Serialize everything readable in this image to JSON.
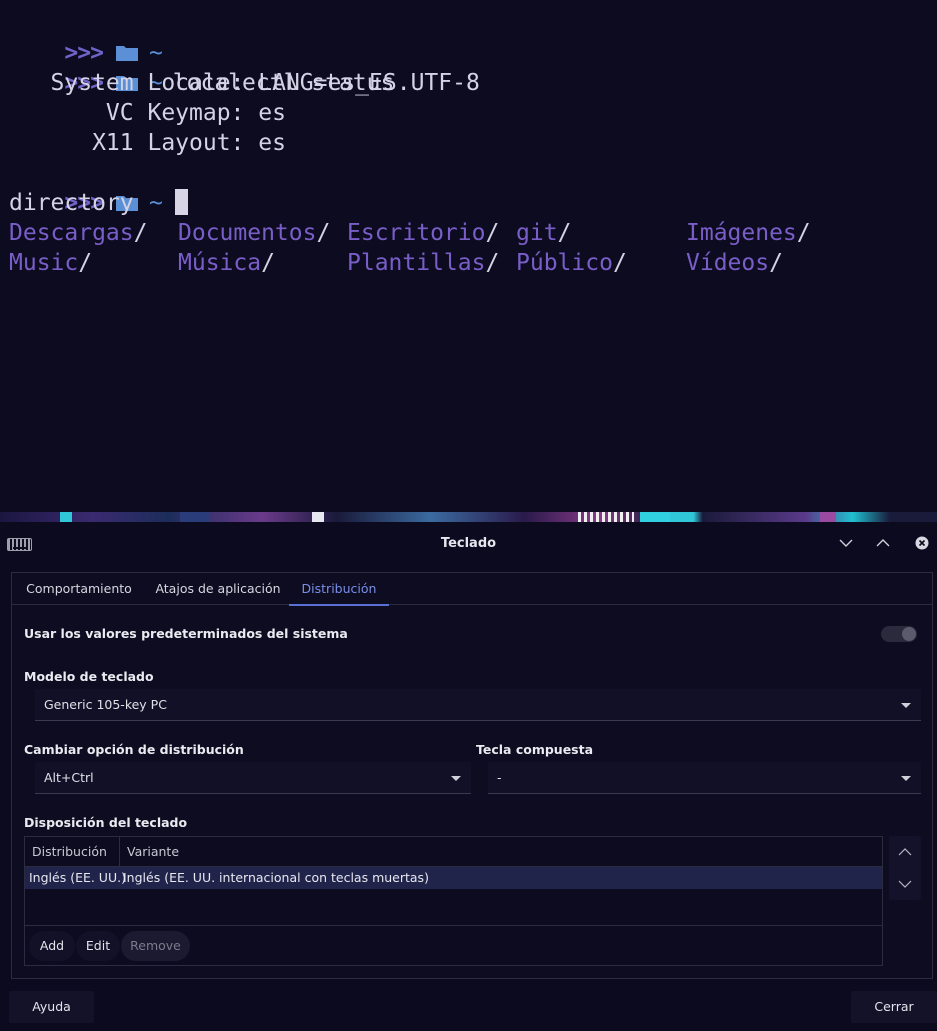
{
  "terminal": {
    "prompt_symbol": ">>>",
    "home_symbol": "~",
    "command": "localectl status",
    "output": [
      "   System Locale: LANG=es_ES.UTF-8",
      "       VC Keymap: es",
      "      X11 Layout: es"
    ],
    "heading": "directory",
    "dirs": [
      "Descargas",
      "Documentos",
      "Escritorio",
      "git",
      "Imágenes",
      "Music",
      "Música",
      "Plantillas",
      "Público",
      "Vídeos"
    ],
    "slash": "/",
    "colors": {
      "prompt": "#6e64c8",
      "home": "#5b8fd6",
      "dir": "#7a5ec8",
      "text": "#d4d2e4"
    }
  },
  "window": {
    "title": "Teclado",
    "icons": [
      "keyboard-icon",
      "minimize-icon",
      "maximize-icon",
      "close-icon"
    ]
  },
  "tabs": [
    "Comportamiento",
    "Atajos de aplicación",
    "Distribución"
  ],
  "active_tab": "Distribución",
  "settings": {
    "use_system_defaults": "Usar los valores predeterminados del sistema",
    "use_system_defaults_on": false,
    "model_label": "Modelo de teclado",
    "model_value": "Generic 105-key PC",
    "switch_label": "Cambiar opción de distribución",
    "switch_value": "Alt+Ctrl",
    "compose_label": "Tecla compuesta",
    "compose_value": "-",
    "layout_label": "Disposición del teclado"
  },
  "layout_table": {
    "columns": [
      "Distribución",
      "Variante"
    ],
    "rows": [
      {
        "distribution": "Inglés (EE. UU.)",
        "variant": "Inglés (EE. UU. internacional con teclas muertas)"
      }
    ],
    "buttons": {
      "add": "Add",
      "edit": "Edit",
      "remove": "Remove"
    }
  },
  "footer": {
    "help": "Ayuda",
    "close": "Cerrar"
  },
  "accent_color": "#5a6fd6"
}
